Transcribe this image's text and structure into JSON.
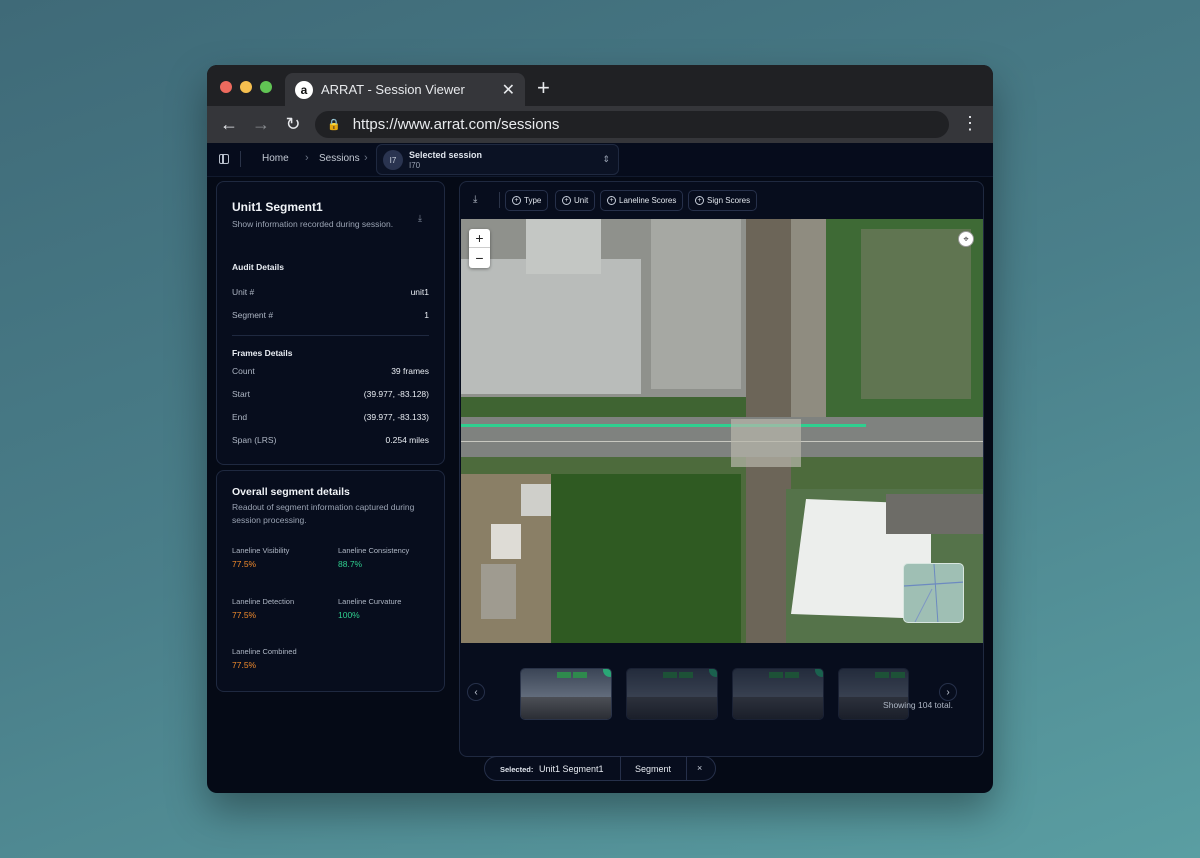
{
  "browser": {
    "tab_title": "ARRAT - Session Viewer",
    "favicon_letter": "a",
    "url": "https://www.arrat.com/sessions"
  },
  "appbar": {
    "breadcrumb_home": "Home",
    "breadcrumb_sessions": "Sessions",
    "session_badge": "I7",
    "session_label": "Selected session",
    "session_value": "I70"
  },
  "segment_card": {
    "title": "Unit1 Segment1",
    "subtitle": "Show information recorded during session.",
    "audit_heading": "Audit Details",
    "unit_label": "Unit #",
    "unit_value": "unit1",
    "segment_label": "Segment #",
    "segment_value": "1",
    "frames_heading": "Frames Details",
    "count_label": "Count",
    "count_value": "39 frames",
    "start_label": "Start",
    "start_value": "(39.977, -83.128)",
    "end_label": "End",
    "end_value": "(39.977, -83.133)",
    "span_label": "Span (LRS)",
    "span_value": "0.254 miles"
  },
  "overall_card": {
    "title": "Overall segment details",
    "subtitle": "Readout of segment information captured during session processing.",
    "metrics": [
      {
        "label": "Laneline Visibility",
        "value": "77.5%"
      },
      {
        "label": "Laneline Consistency",
        "value": "88.7%"
      },
      {
        "label": "Laneline Detection",
        "value": "77.5%"
      },
      {
        "label": "Laneline Curvature",
        "value": "100%"
      },
      {
        "label": "Laneline Combined",
        "value": "77.5%"
      }
    ]
  },
  "toolbar": {
    "filters": [
      "Type",
      "Unit",
      "Laneline Scores",
      "Sign Scores"
    ]
  },
  "map": {
    "zoom_in": "+",
    "zoom_out": "−"
  },
  "carousel": {
    "showing_text": "Showing 104 total."
  },
  "selection": {
    "label": "Selected:",
    "value": "Unit1 Segment1",
    "type": "Segment",
    "close": "×"
  },
  "colors": {
    "accent_green": "#2fcf8f",
    "accent_orange": "#f08a2c",
    "background": "#050a16"
  }
}
